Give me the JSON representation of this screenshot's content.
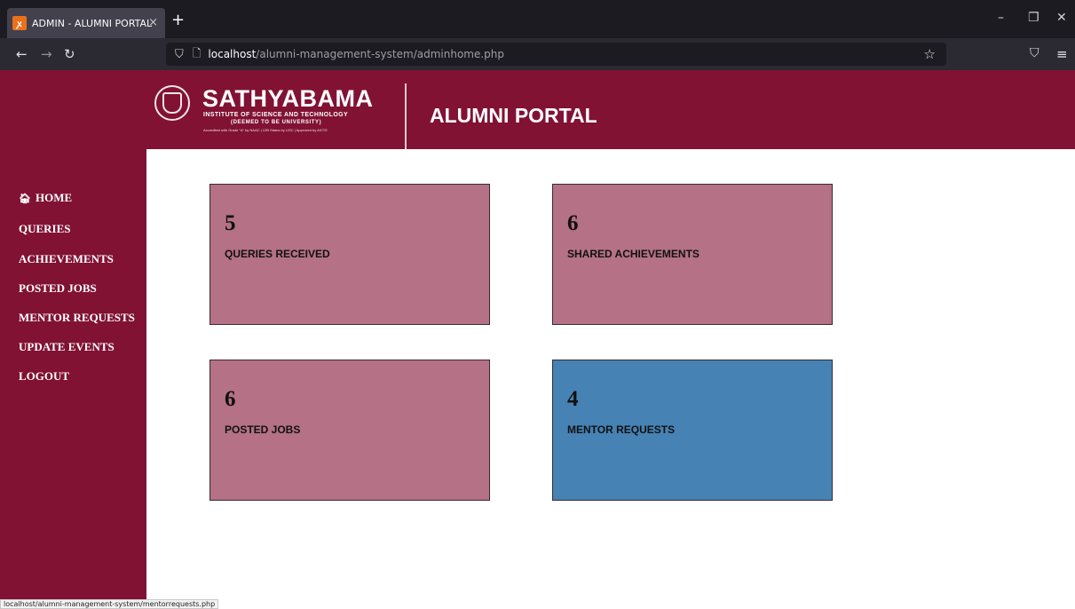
{
  "browser": {
    "tab_title": "ADMIN - ALUMNI PORTAL",
    "tab_favicon": "xampp-icon",
    "tab_close": "×",
    "new_tab": "+",
    "url_host": "localhost",
    "url_path": "/alumni-management-system/adminhome.php",
    "status_url": "localhost/alumni-management-system/mentorrequests.php"
  },
  "header": {
    "logo_name": "SATHYABAMA",
    "logo_sub": "INSTITUTE OF SCIENCE AND TECHNOLOGY",
    "logo_sub2": "(DEEMED TO BE UNIVERSITY)",
    "logo_accreditation": "Accredited with Grade \"A\" by NAAC | 12B Status by UGC | Approved by AICTE",
    "portal_title": "ALUMNI PORTAL"
  },
  "sidebar": {
    "items": [
      {
        "label": "HOME",
        "icon": "home-icon"
      },
      {
        "label": "QUERIES"
      },
      {
        "label": "ACHIEVEMENTS"
      },
      {
        "label": "POSTED JOBS"
      },
      {
        "label": "MENTOR REQUESTS"
      },
      {
        "label": "UPDATE EVENTS"
      },
      {
        "label": "LOGOUT"
      }
    ]
  },
  "cards": [
    {
      "count": "5",
      "label": "QUERIES RECEIVED",
      "color": "#b57186"
    },
    {
      "count": "6",
      "label": "SHARED ACHIEVEMENTS",
      "color": "#b57186"
    },
    {
      "count": "6",
      "label": "POSTED JOBS",
      "color": "#b57186"
    },
    {
      "count": "4",
      "label": "MENTOR REQUESTS",
      "color": "#4682b4"
    }
  ],
  "colors": {
    "brand": "#811234",
    "card_default": "#b57186",
    "card_hover": "#4682b4"
  }
}
